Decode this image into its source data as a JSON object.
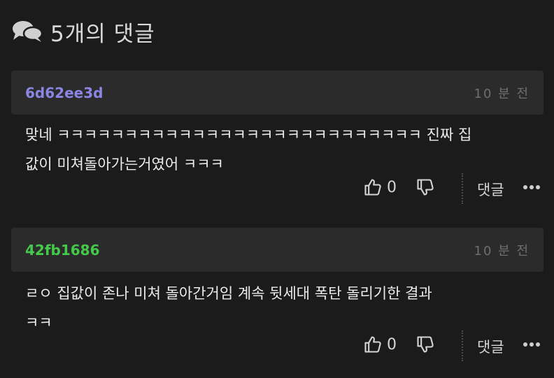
{
  "header": {
    "title": "5개의 댓글",
    "icon": "comments-icon"
  },
  "comments": [
    {
      "author": "6d62ee3d",
      "author_color": "#8b86e4",
      "time": "10 분 전",
      "lines": [
        "맞네 ㅋㅋㅋㅋㅋㅋㅋㅋㅋㅋㅋㅋㅋㅋㅋㅋㅋㅋㅋㅋㅋㅋㅋㅋㅋㅋㅋ 진짜 집",
        "값이 미쳐돌아가는거였어 ㅋㅋㅋ"
      ],
      "likes": "0",
      "reply_label": "댓글"
    },
    {
      "author": "42fb1686",
      "author_color": "#45c94a",
      "time": "10 분 전",
      "lines": [
        "ㄹㅇ 집값이 존나 미쳐 돌아간거임 계속 뒷세대 폭탄 돌리기한 결과",
        "ㅋㅋ"
      ],
      "likes": "0",
      "reply_label": "댓글"
    }
  ]
}
